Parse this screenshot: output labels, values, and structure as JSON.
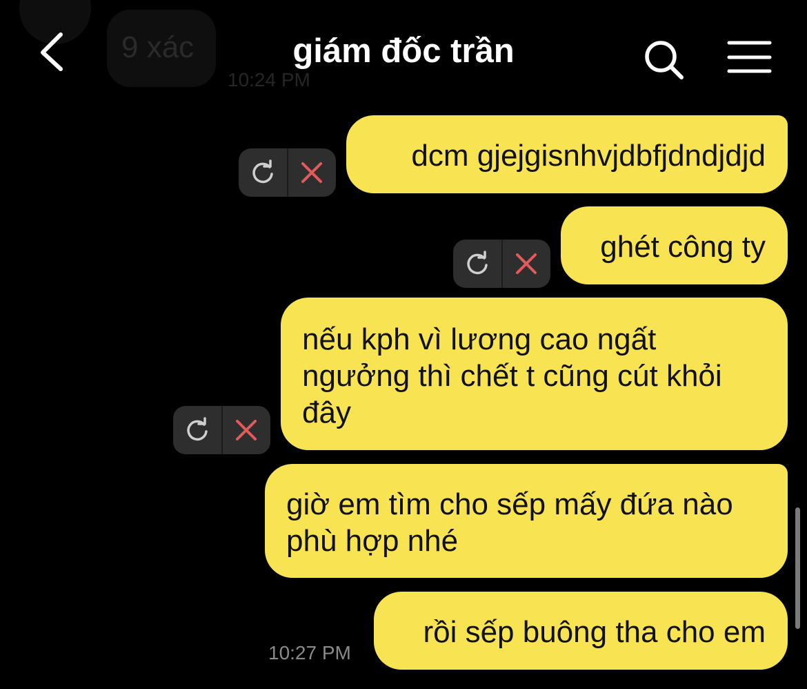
{
  "previous": {
    "message": "9 xác",
    "time": "10:24 PM"
  },
  "header": {
    "title": "giám đốc trần",
    "back_icon": "chevron-left-icon",
    "search_icon": "search-icon",
    "menu_icon": "hamburger-menu-icon"
  },
  "messages": [
    {
      "text": "dcm gjejgisnhvjdbfjdndjdjd",
      "status": "failed"
    },
    {
      "text": "ghét công ty",
      "status": "failed"
    },
    {
      "text": "nếu kph vì lương cao ngất\nngưởng thì chết t cũng cút khỏi\nđây",
      "status": "failed"
    },
    {
      "text": "giờ em tìm cho sếp mấy đứa nào\nphù hợp nhé",
      "status": "sent"
    },
    {
      "text": "rồi sếp buông tha cho em",
      "status": "sent"
    }
  ],
  "timestamp": "10:27 PM",
  "colors": {
    "background": "#000000",
    "bubble": "#f8e352",
    "bubble_text": "#111111",
    "retry_icon": "#cfcfcf",
    "delete_icon": "#e25b5b"
  },
  "icons": {
    "retry": "retry-icon",
    "delete": "close-icon"
  }
}
